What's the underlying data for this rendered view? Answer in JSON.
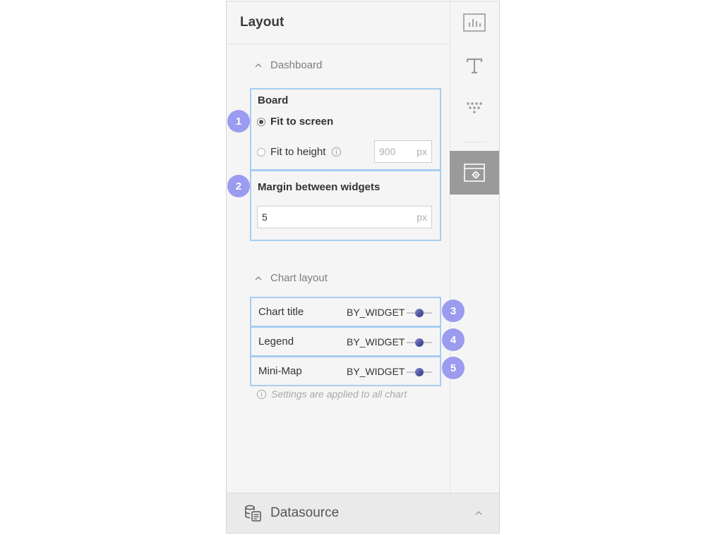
{
  "panel": {
    "title": "Layout",
    "dashboard_section": {
      "header": "Dashboard",
      "board": {
        "label": "Board",
        "options": [
          {
            "label": "Fit to screen",
            "selected": true
          },
          {
            "label": "Fit to height",
            "selected": false
          }
        ],
        "height_value": "900",
        "height_unit": "px"
      },
      "margin": {
        "label": "Margin between widgets",
        "value": "5",
        "unit": "px"
      }
    },
    "chart_layout_section": {
      "header": "Chart layout",
      "rows": [
        {
          "label": "Chart title",
          "value": "BY_WIDGET"
        },
        {
          "label": "Legend",
          "value": "BY_WIDGET"
        },
        {
          "label": "Mini-Map",
          "value": "BY_WIDGET"
        }
      ],
      "note": "Settings are applied to all chart"
    },
    "badges": [
      "1",
      "2",
      "3",
      "4",
      "5"
    ]
  },
  "sidebar": {
    "icons": [
      "chart-icon",
      "text-format-icon",
      "funnel-dots-icon",
      "layout-settings-icon"
    ],
    "active": "layout-settings-icon"
  },
  "footer": {
    "label": "Datasource",
    "icon": "datasource-icon"
  },
  "colors": {
    "highlight_border": "#a7cdf0",
    "badge": "#9b9bf0",
    "active_tab": "#9a9a9a"
  }
}
